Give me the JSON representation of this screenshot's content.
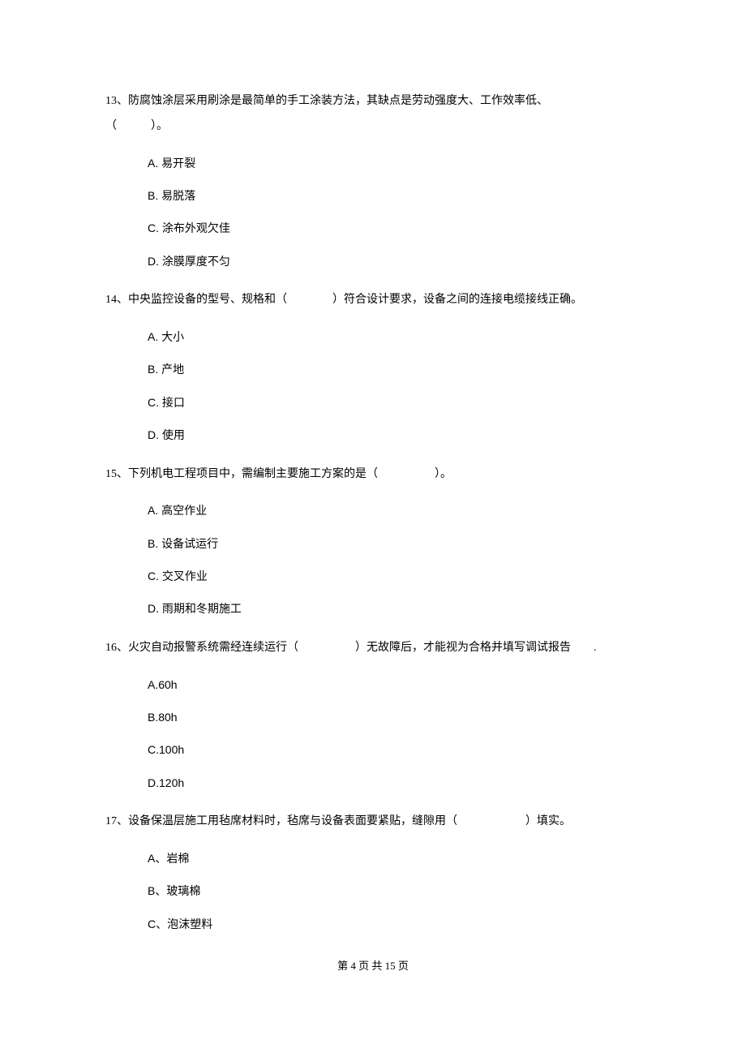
{
  "questions": [
    {
      "number": "13、",
      "stem_part1": "防腐蚀涂层采用刷涂是最简单的手工涂装方法，其缺点是劳动强度大、工作效率低、",
      "stem_part2": "（　　　）。",
      "options": [
        "A. 易开裂",
        "B. 易脱落",
        "C. 涂布外观欠佳",
        "D. 涂膜厚度不匀"
      ]
    },
    {
      "number": "14、",
      "stem_part1": "中央监控设备的型号、规格和（　　　　）符合设计要求，设备之间的连接电缆接线正确。",
      "stem_part2": "",
      "options": [
        "A. 大小",
        "B. 产地",
        "C. 接口",
        "D. 使用"
      ]
    },
    {
      "number": "15、",
      "stem_part1": "下列机电工程项目中，需编制主要施工方案的是（　　　　　）。",
      "stem_part2": "",
      "options": [
        "A. 高空作业",
        "B. 设备试运行",
        "C. 交叉作业",
        "D. 雨期和冬期施工"
      ]
    },
    {
      "number": "16、",
      "stem_part1": "火灾自动报警系统需经连续运行（　　　　　）无故障后，才能视为合格并填写调试报告　　.",
      "stem_part2": "",
      "options": [
        "A.60h",
        "B.80h",
        "C.100h",
        "D.120h"
      ]
    },
    {
      "number": "17、",
      "stem_part1": "设备保温层施工用毡席材料时，毡席与设备表面要紧贴，缝隙用（　　　　　　）填实。",
      "stem_part2": "",
      "options": [
        "A、岩棉",
        "B、玻璃棉",
        "C、泡沫塑料"
      ]
    }
  ],
  "footer": "第 4 页 共 15 页"
}
